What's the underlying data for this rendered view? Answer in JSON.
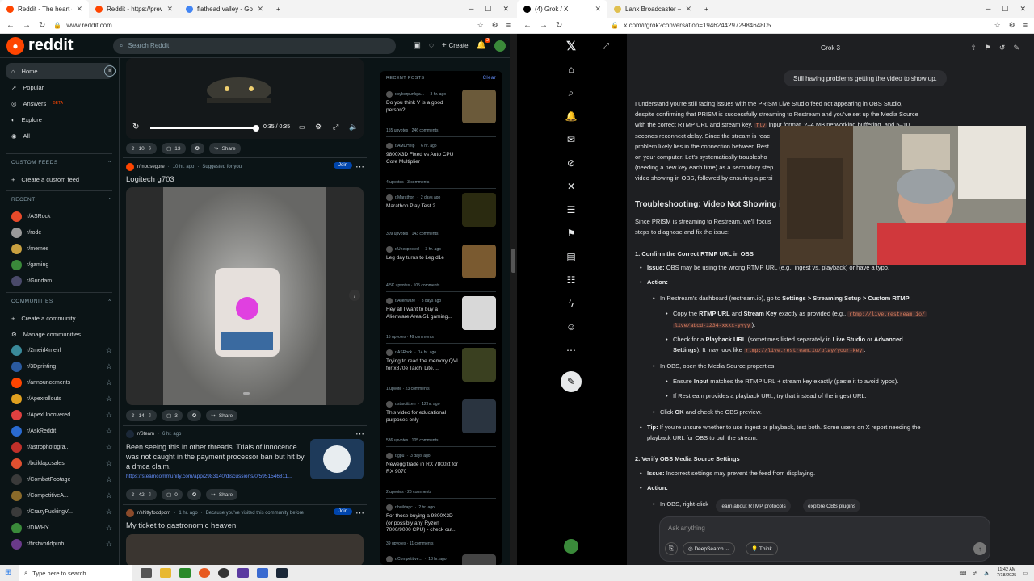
{
  "left_browser": {
    "tabs": [
      {
        "title": "Reddit - The heart of the intern",
        "active": true
      },
      {
        "title": "Reddit - https://preview.redd.i",
        "active": false
      },
      {
        "title": "flathead valley - Google Search",
        "active": false
      }
    ],
    "url": "www.reddit.com"
  },
  "right_browser": {
    "tabs": [
      {
        "title": "(4) Grok / X",
        "active": true
      },
      {
        "title": "Lanx Broadcaster – Softwaium",
        "active": false
      }
    ],
    "url": "x.com/i/grok?conversation=1946244297298464805"
  },
  "reddit": {
    "logo": "reddit",
    "search_placeholder": "Search Reddit",
    "create_label": "Create",
    "notif_count": "2",
    "nav": [
      {
        "label": "Home",
        "icon": "home-icon"
      },
      {
        "label": "Popular",
        "icon": "popular-icon"
      },
      {
        "label": "Answers",
        "badge": "BETA",
        "icon": "answers-icon"
      },
      {
        "label": "Explore",
        "icon": "explore-icon"
      },
      {
        "label": "All",
        "icon": "all-icon"
      }
    ],
    "custom_feeds_heading": "CUSTOM FEEDS",
    "create_custom_feed": "Create a custom feed",
    "recent_heading": "RECENT",
    "recent": [
      "r/ASRock",
      "r/rode",
      "r/memes",
      "r/gaming",
      "r/Gundam"
    ],
    "communities_heading": "COMMUNITIES",
    "create_community": "Create a community",
    "manage_communities": "Manage communities",
    "communities": [
      "r/2meirl4meirl",
      "r/3Dprinting",
      "r/announcements",
      "r/Apexrollouts",
      "r/ApexUncovered",
      "r/AskReddit",
      "r/astrophotogra...",
      "r/buildapcsales",
      "r/CombatFootage",
      "r/CompetitiveA...",
      "r/CrazyFuckingV...",
      "r/DIWHY",
      "r/firstworldprob..."
    ],
    "video": {
      "time": "0:35 / 0:35",
      "progress": 1.0
    },
    "post0_actions": {
      "votes": "10",
      "comments": "13",
      "share": "Share"
    },
    "post1": {
      "sub": "r/mousegore",
      "age": "10 hr. ago",
      "reason": "Suggested for you",
      "join": "Join",
      "title": "Logitech g703",
      "votes": "14",
      "comments": "3",
      "share": "Share"
    },
    "post2": {
      "sub": "r/Steam",
      "age": "6 hr. ago",
      "title": "Been seeing this in other threads. Trials of innocence was not caught in the payment processor ban but hit by a dmca claim.",
      "link": "https://steamcommunity.com/app/2983140/discussions/0/5951546811...",
      "votes": "42",
      "comments": "0",
      "share": "Share"
    },
    "post3": {
      "sub": "r/shittyfoodporn",
      "age": "1 hr. ago",
      "reason": "Because you've visited this community before",
      "join": "Join",
      "title": "My ticket to gastronomic heaven"
    },
    "recent_posts_heading": "RECENT POSTS",
    "recent_posts_clear": "Clear",
    "recent_posts": [
      {
        "sub": "r/cyberpunkga...",
        "age": "3 hr. ago",
        "title": "Do you think V is a good person?",
        "stats": "155 upvotes · 246 comments",
        "thumb": "#6b5a3a"
      },
      {
        "sub": "r/AMDHelp",
        "age": "6 hr. ago",
        "title": "9800X3D Fixed vs Auto CPU Core Multiplier",
        "stats": "4 upvotes · 3 comments",
        "thumb": ""
      },
      {
        "sub": "r/Marathon",
        "age": "2 days ago",
        "title": "Marathon Play Test 2",
        "stats": "309 upvotes · 143 comments",
        "thumb": "#2a2a10"
      },
      {
        "sub": "r/Unexpected",
        "age": "3 hr. ago",
        "title": "Leg day turns to Leg d1e",
        "stats": "4.5K upvotes · 105 comments",
        "thumb": "#7a5a30"
      },
      {
        "sub": "r/Alienware",
        "age": "3 days ago",
        "title": "Hey all I want to buy a Alienware Area-51 gaming...",
        "stats": "15 upvotes · 49 comments",
        "thumb": "#d8d8d8"
      },
      {
        "sub": "r/ASRock",
        "age": "14 hr. ago",
        "title": "Trying to read the memory QVL for x870e Taichi Lite,...",
        "stats": "1 upvote · 23 comments",
        "thumb": "#3a4020"
      },
      {
        "sub": "r/starcitizen",
        "age": "12 hr. ago",
        "title": "This video for educational purposes only",
        "stats": "536 upvotes · 105 comments",
        "thumb": "#2a3440"
      },
      {
        "sub": "r/gpu",
        "age": "3 days ago",
        "title": "Newegg trade in RX 7800xt for RX 9070",
        "stats": "2 upvotes · 26 comments",
        "thumb": ""
      },
      {
        "sub": "r/buildapc",
        "age": "2 hr. ago",
        "title": "For those buying a 9800X3D (or possibly any Ryzen 7000/9000 CPU) - check out...",
        "stats": "39 upvotes · 11 comments",
        "thumb": ""
      },
      {
        "sub": "r/Competitive...",
        "age": "13 hr. ago",
        "title": "Guild Esports has not paid",
        "stats": "",
        "thumb": "#444"
      }
    ]
  },
  "grok": {
    "model": "Grok 3",
    "user_message": "Still having problems getting the video to show up.",
    "intro": [
      "I understand you're still facing issues with the PRISM Live Studio feed not appearing in OBS Studio,",
      "despite confirming that PRISM is successfully streaming to Restream and you've set up the Media Source",
      "with the correct RTMP URL and stream key,",
      "input format, 2–4 MB networking buffering, and 5–10",
      "seconds reconnect delay. Since the stream is reac",
      "problem likely lies in the connection between Rest",
      "on your computer. Let's systematically troublesho",
      "(needing a new key each time) as a secondary step",
      "video showing in OBS, followed by ensuring a persi"
    ],
    "intro_code": "flv",
    "heading": "Troubleshooting: Video Not Showing i",
    "heading_intro": [
      "Since PRISM is streaming to Restream, we'll focus",
      "steps to diagnose and fix the issue:"
    ],
    "s1_title": "1. Confirm the Correct RTMP URL in OBS",
    "s1_issue_label": "Issue:",
    "s1_issue": "OBS may be using the wrong RTMP URL (e.g., ingest vs. playback) or have a typo.",
    "action_label": "Action:",
    "s1_a1_pre": "In Restream's dashboard (restream.io), go to",
    "s1_a1_bold": "Settings > Streaming Setup > Custom RTMP",
    "s1_a2_pre": "Copy the",
    "s1_a2_b1": "RTMP URL",
    "s1_a2_and": "and",
    "s1_a2_b2": "Stream Key",
    "s1_a2_post": "exactly as provided (e.g.,",
    "s1_a2_code1": "rtmp://live.restream.io/",
    "s1_a2_code2": "live/abcd-1234-xxxx-yyyy",
    "s1_a3_pre": "Check for a",
    "s1_a3_b1": "Playback URL",
    "s1_a3_mid": "(sometimes listed separately in",
    "s1_a3_b2": "Live Studio",
    "s1_a3_or": "or",
    "s1_a3_b3": "Advanced",
    "s1_a3_b4": "Settings",
    "s1_a3_post": "). It may look like",
    "s1_a3_code": "rtmp://live.restream.io/play/your-key",
    "s1_a4": "In OBS, open the Media Source properties:",
    "s1_a5_pre": "Ensure",
    "s1_a5_b": "Input",
    "s1_a5_post": "matches the RTMP URL + stream key exactly (paste it to avoid typos).",
    "s1_a6": "If Restream provides a playback URL, try that instead of the ingest URL.",
    "s1_a7_pre": "Click",
    "s1_a7_b": "OK",
    "s1_a7_post": "and check the OBS preview.",
    "s1_tip_label": "Tip:",
    "s1_tip": [
      "If you're unsure whether to use ingest or playback, test both. Some users on X report needing the",
      "playback URL for OBS to pull the stream."
    ],
    "s2_title": "2. Verify OBS Media Source Settings",
    "s2_issue": "Incorrect settings may prevent the feed from displaying.",
    "s2_a1": "In OBS, right-click",
    "suggestions": [
      "learn about RTMP protocols",
      "explore OBS plugins"
    ],
    "input_placeholder": "Ask anything",
    "deepsearch_label": "DeepSearch",
    "think_label": "Think"
  },
  "taskbar": {
    "search_placeholder": "Type here to search",
    "time": "11:42 AM",
    "date": "7/18/2025"
  }
}
